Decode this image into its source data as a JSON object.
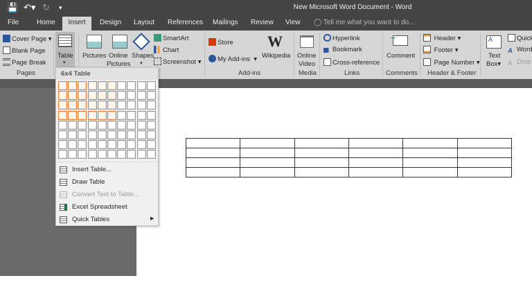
{
  "window": {
    "title": "New Microsoft Word Document - Word"
  },
  "quick_access": {
    "save_icon": "save-icon",
    "undo_icon": "undo-icon",
    "redo_icon": "redo-icon",
    "customize_icon": "customize-icon"
  },
  "tabs": [
    "File",
    "Home",
    "Insert",
    "Design",
    "Layout",
    "References",
    "Mailings",
    "Review",
    "View"
  ],
  "active_tab": "Insert",
  "tell_me": "Tell me what you want to do...",
  "ribbon": {
    "pages": {
      "label": "Pages",
      "items": [
        "Cover Page",
        "Blank Page",
        "Page Break"
      ]
    },
    "tables": {
      "table": "Table"
    },
    "illustrations": {
      "pictures": "Pictures",
      "online_pictures": [
        "Online",
        "Pictures"
      ],
      "shapes": "Shapes",
      "smartart": "SmartArt",
      "chart": "Chart",
      "screenshot": "Screenshot"
    },
    "addins": {
      "label": "Add-ins",
      "store": "Store",
      "my_addins": "My Add-ins",
      "wikipedia": "Wikipedia"
    },
    "media": {
      "label": "Media",
      "online_video": [
        "Online",
        "Video"
      ]
    },
    "links": {
      "label": "Links",
      "items": [
        "Hyperlink",
        "Bookmark",
        "Cross-reference"
      ]
    },
    "comments": {
      "label": "Comments",
      "comment": "Comment"
    },
    "header_footer": {
      "label": "Header & Footer",
      "items": [
        "Header",
        "Footer",
        "Page Number"
      ]
    },
    "text": {
      "text_box": [
        "Text",
        "Box"
      ],
      "quick": "Quick",
      "wordart": "Word",
      "drop": "Drop"
    }
  },
  "table_menu": {
    "title": "6x4 Table",
    "grid_columns": 10,
    "grid_rows": 8,
    "selected_columns": 6,
    "selected_rows": 4,
    "highlight_color": "#f07b31",
    "items": [
      {
        "label": "Insert Table...",
        "enabled": true,
        "icon": "insert-table-icon"
      },
      {
        "label": "Draw Table",
        "enabled": true,
        "icon": "draw-table-icon"
      },
      {
        "label": "Convert Text to Table...",
        "enabled": false,
        "icon": "convert-text-icon"
      },
      {
        "label": "Excel Spreadsheet",
        "enabled": true,
        "icon": "excel-icon"
      },
      {
        "label": "Quick Tables",
        "enabled": true,
        "icon": "quick-tables-icon",
        "submenu": true
      }
    ]
  },
  "document": {
    "table_columns": 6,
    "table_rows": 4
  }
}
